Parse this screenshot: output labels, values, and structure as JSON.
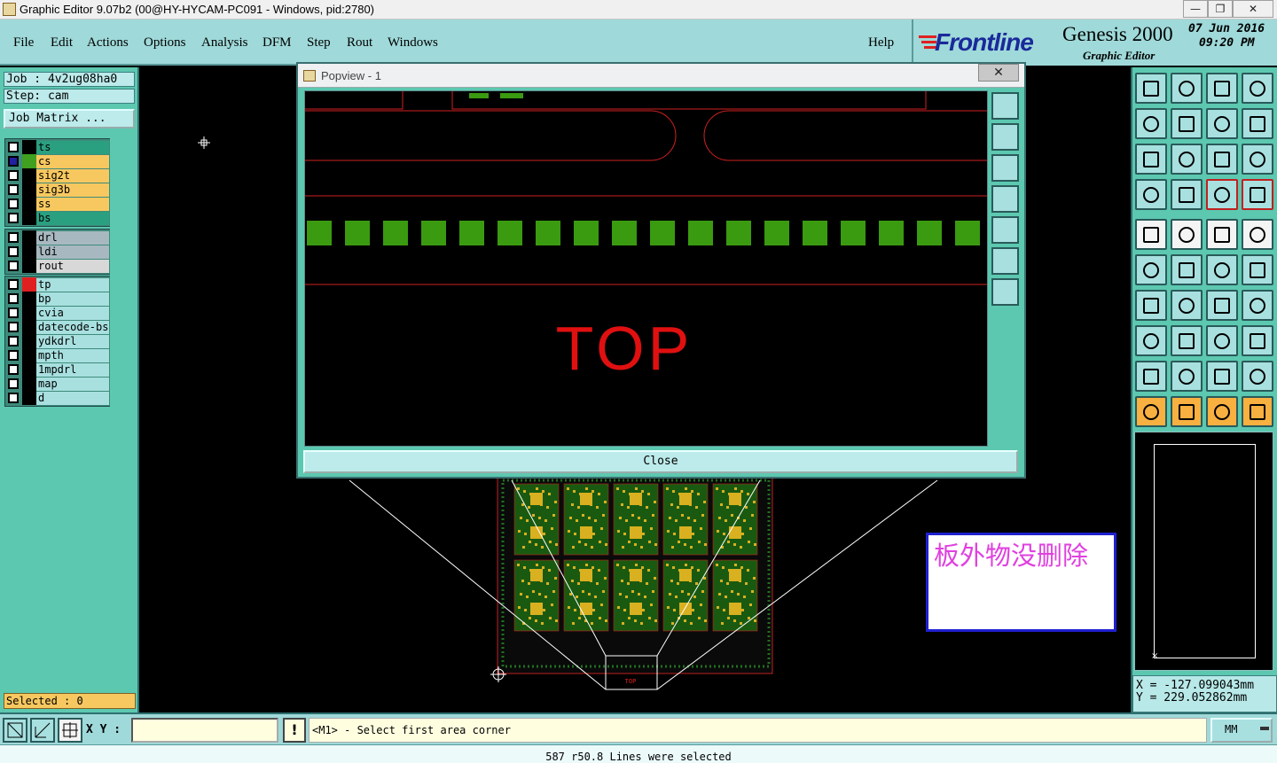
{
  "window": {
    "title": "Graphic Editor 9.07b2 (00@HY-HYCAM-PC091 - Windows, pid:2780)",
    "controls": [
      "—",
      "❐",
      "✕"
    ]
  },
  "menu": {
    "items": [
      "File",
      "Edit",
      "Actions",
      "Options",
      "Analysis",
      "DFM",
      "Step",
      "Rout",
      "Windows"
    ],
    "help": "Help"
  },
  "brand": {
    "logo": "Frontline",
    "product": "Genesis 2000",
    "subtitle": "Graphic Editor",
    "date": "07 Jun 2016",
    "time": "09:20 PM"
  },
  "job": {
    "job_label": "Job : 4v2ug08ha0",
    "step_label": "Step: cam",
    "matrix_button": "Job Matrix ..."
  },
  "layers": {
    "group1": [
      {
        "name": "ts",
        "color": "#2aa080",
        "swatch": "#000000",
        "selected": false
      },
      {
        "name": "cs",
        "color": "#f8c860",
        "swatch": "#40a020",
        "selected": true
      },
      {
        "name": "sig2t",
        "color": "#f8c860",
        "swatch": "#000000",
        "selected": false
      },
      {
        "name": "sig3b",
        "color": "#f8c860",
        "swatch": "#000000",
        "selected": false
      },
      {
        "name": "ss",
        "color": "#f8c860",
        "swatch": "#000000",
        "selected": false
      },
      {
        "name": "bs",
        "color": "#2aa080",
        "swatch": "#000000",
        "selected": false
      }
    ],
    "group2": [
      {
        "name": "drl",
        "color": "#a8b8c0",
        "swatch": "#000000",
        "selected": false
      },
      {
        "name": "ldi",
        "color": "#a8b8c0",
        "swatch": "#000000",
        "selected": false
      },
      {
        "name": "rout",
        "color": "#d8d8d8",
        "swatch": "#000000",
        "selected": false
      }
    ],
    "group3": [
      {
        "name": "tp",
        "color": "#a8e0e0",
        "swatch": "#e02020",
        "selected": false
      },
      {
        "name": "bp",
        "color": "#a8e0e0",
        "swatch": "#000000",
        "selected": false
      },
      {
        "name": "cvia",
        "color": "#a8e0e0",
        "swatch": "#000000",
        "selected": false
      },
      {
        "name": "datecode-bs",
        "color": "#a8e0e0",
        "swatch": "#000000",
        "selected": false
      },
      {
        "name": "ydkdrl",
        "color": "#a8e0e0",
        "swatch": "#000000",
        "selected": false
      },
      {
        "name": "mpth",
        "color": "#a8e0e0",
        "swatch": "#000000",
        "selected": false
      },
      {
        "name": "1mpdrl",
        "color": "#a8e0e0",
        "swatch": "#000000",
        "selected": false
      },
      {
        "name": "map",
        "color": "#a8e0e0",
        "swatch": "#000000",
        "selected": false
      },
      {
        "name": "d",
        "color": "#a8e0e0",
        "swatch": "#000000",
        "selected": false
      }
    ]
  },
  "selected_text": "Selected : 0",
  "popview": {
    "title": "Popview - 1",
    "close_x": "✕",
    "close_button": "Close",
    "board_text": "TOP"
  },
  "board": {
    "label": "TOP"
  },
  "annotation": {
    "text": "板外物没删除",
    "color": "#e040e0"
  },
  "coords": {
    "x": "X = -127.099043mm",
    "y": "Y = 229.052862mm"
  },
  "command": {
    "xy_label": "X Y :",
    "xy_value": "",
    "excl": "!",
    "prompt": "<M1> - Select first area corner",
    "units": "MM"
  },
  "status": {
    "message": "587 r50.8 Lines were selected"
  },
  "right_tools": [
    [
      "teal",
      "teal",
      "teal",
      "teal"
    ],
    [
      "teal",
      "teal",
      "teal",
      "teal"
    ],
    [
      "teal",
      "teal",
      "teal",
      "teal"
    ],
    [
      "teal",
      "teal",
      "red",
      "red"
    ],
    [
      "white",
      "white",
      "white",
      "white"
    ],
    [
      "teal",
      "teal",
      "teal",
      "teal"
    ],
    [
      "teal",
      "teal",
      "teal",
      "teal"
    ],
    [
      "teal",
      "teal",
      "teal",
      "teal"
    ],
    [
      "teal",
      "teal",
      "teal",
      "teal"
    ],
    [
      "orange",
      "orange",
      "orange",
      "orange"
    ]
  ]
}
